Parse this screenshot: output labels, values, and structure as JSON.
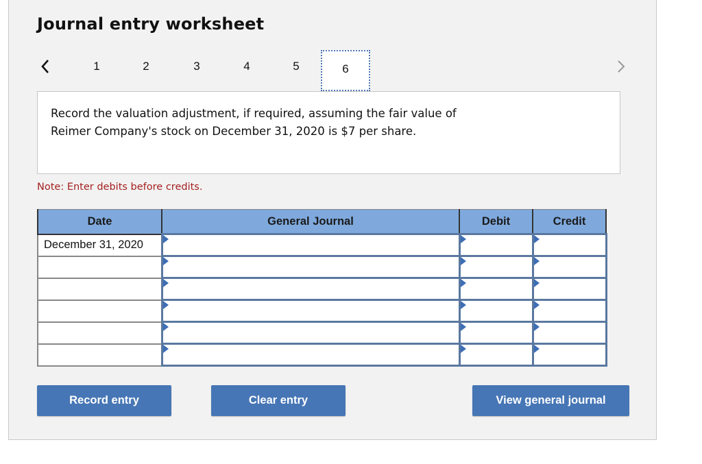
{
  "header": {
    "title": "Journal entry worksheet"
  },
  "navigation": {
    "prev_icon": "chevron-left-icon",
    "next_icon": "chevron-right-icon",
    "steps": [
      "1",
      "2",
      "3",
      "4",
      "5",
      "6"
    ],
    "active_step": "6"
  },
  "prompt": {
    "line1": "Record the valuation adjustment, if required, assuming the fair value of",
    "line2": "Reimer Company's stock on December 31, 2020 is $7 per share."
  },
  "note": "Note: Enter debits before credits.",
  "journal": {
    "columns": [
      "Date",
      "General Journal",
      "Debit",
      "Credit"
    ],
    "rows": [
      {
        "date": "December 31, 2020",
        "account": "",
        "debit": "",
        "credit": ""
      },
      {
        "date": "",
        "account": "",
        "debit": "",
        "credit": ""
      },
      {
        "date": "",
        "account": "",
        "debit": "",
        "credit": ""
      },
      {
        "date": "",
        "account": "",
        "debit": "",
        "credit": ""
      },
      {
        "date": "",
        "account": "",
        "debit": "",
        "credit": ""
      },
      {
        "date": "",
        "account": "",
        "debit": "",
        "credit": ""
      }
    ]
  },
  "buttons": {
    "record": "Record entry",
    "clear": "Clear entry",
    "view": "View general journal"
  },
  "colors": {
    "header_bg": "#7fa9dd",
    "button_bg": "#4676b5",
    "note_text": "#a52020",
    "active_step_border": "#4a76b5"
  }
}
